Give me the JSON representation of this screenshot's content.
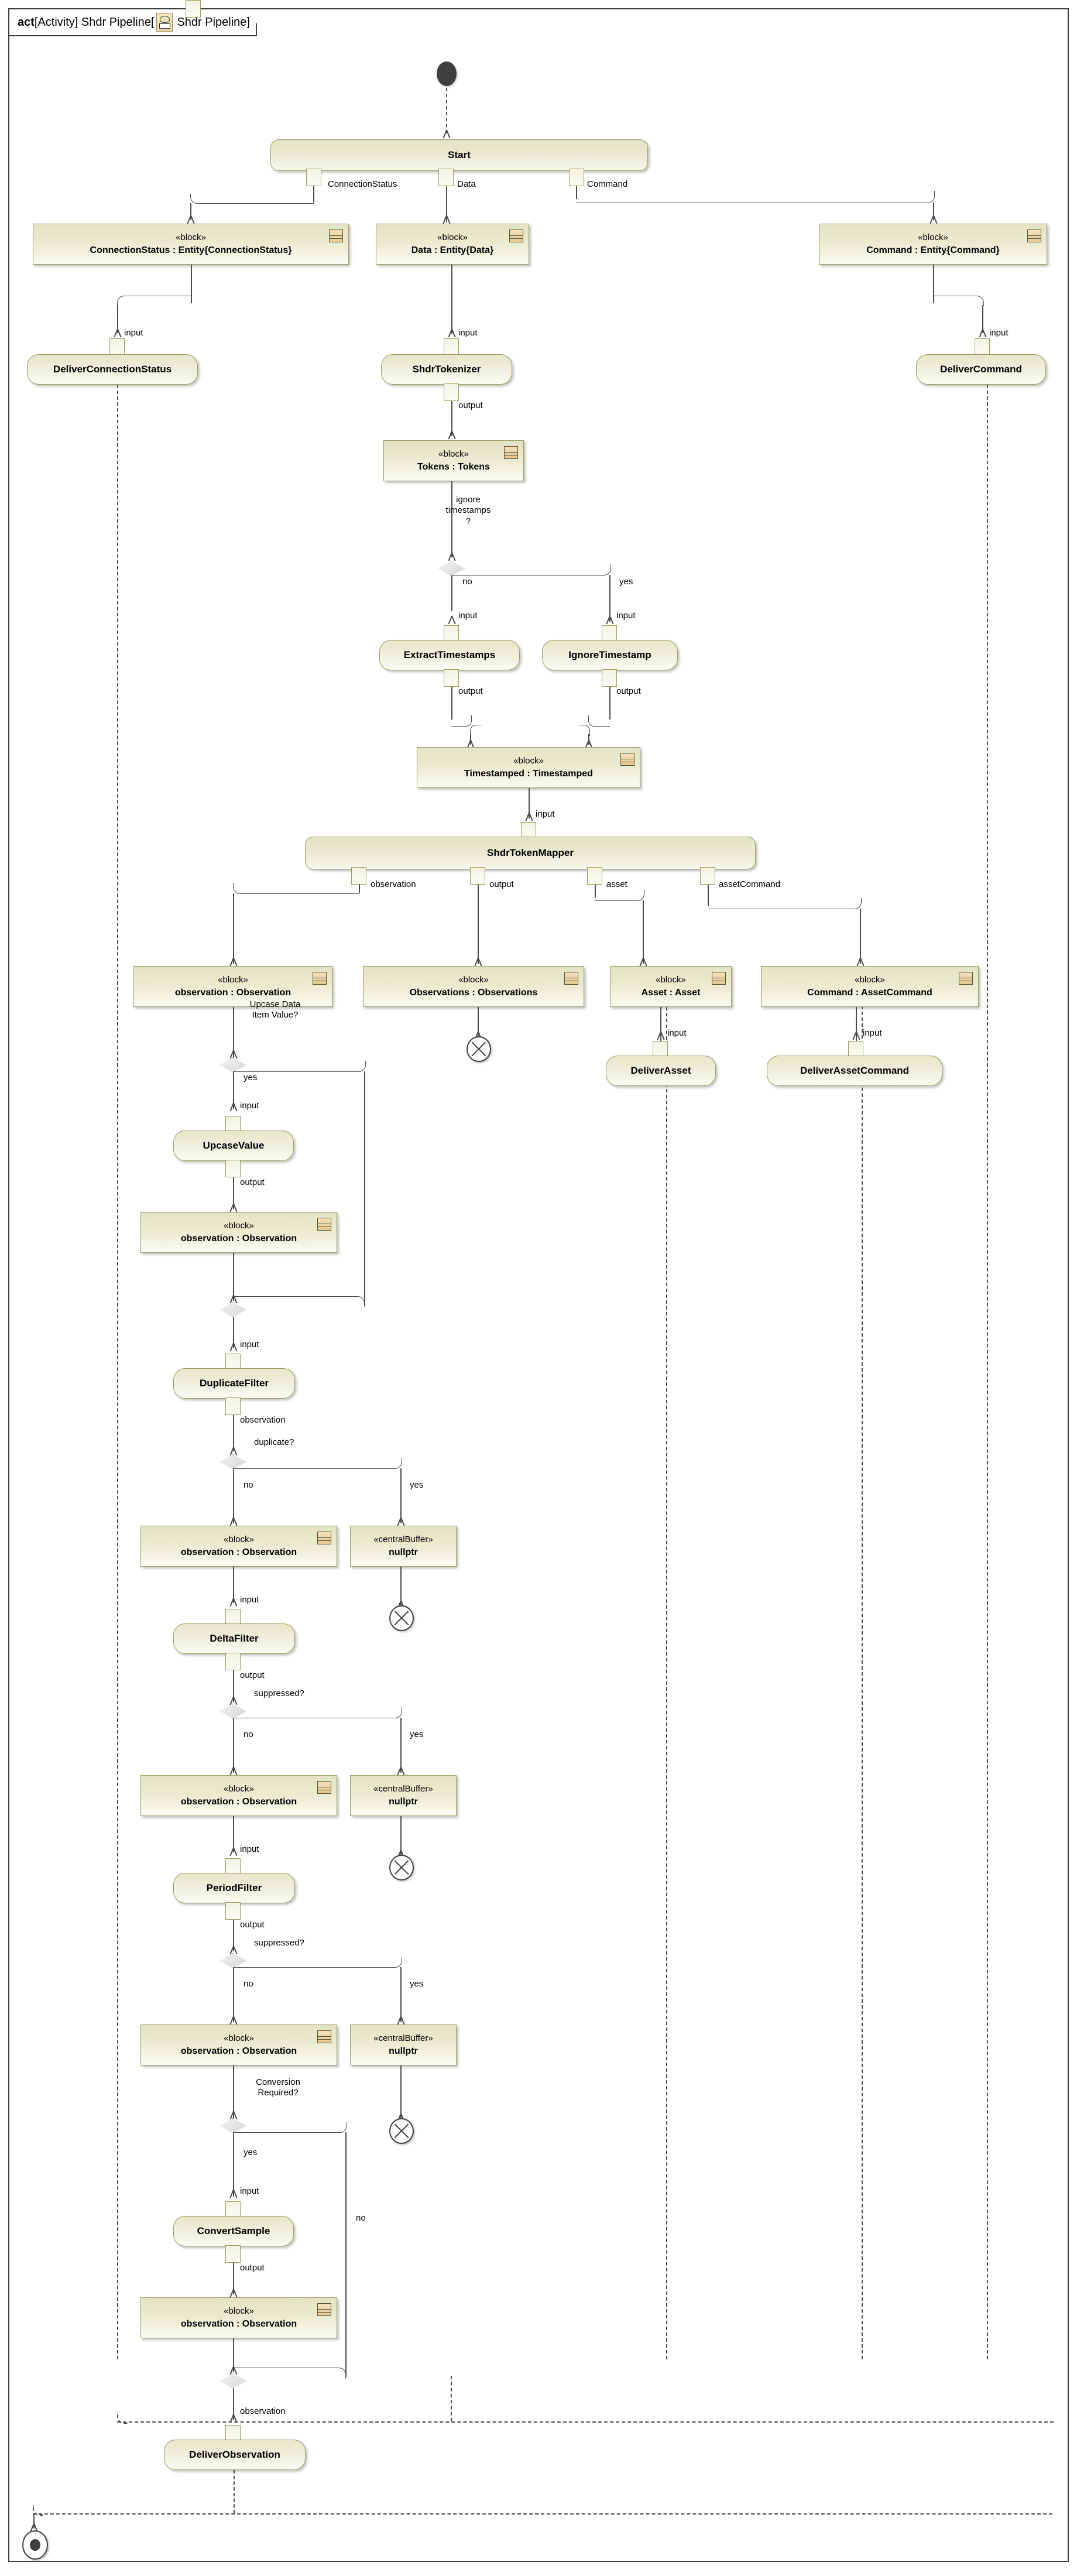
{
  "frame": {
    "keyword": "act",
    "title": " [Activity] Shdr Pipeline[ ",
    "title_tail": " Shdr Pipeline]",
    "icon": "activity-diagram-icon"
  },
  "nodes": {
    "initial": {
      "name": "initial-node"
    },
    "start": {
      "label": "Start"
    },
    "connection_status_block": {
      "stereotype": "«block»",
      "name": "ConnectionStatus : Entity{ConnectionStatus}"
    },
    "data_block": {
      "stereotype": "«block»",
      "name": "Data : Entity{Data}"
    },
    "command_block": {
      "stereotype": "«block»",
      "name": "Command : Entity{Command}"
    },
    "deliver_connection_status": {
      "label": "DeliverConnectionStatus"
    },
    "shdr_tokenizer": {
      "label": "ShdrTokenizer"
    },
    "deliver_command": {
      "label": "DeliverCommand"
    },
    "tokens_block": {
      "stereotype": "«block»",
      "name": "Tokens : Tokens"
    },
    "extract_timestamps": {
      "label": "ExtractTimestamps"
    },
    "ignore_timestamp": {
      "label": "IgnoreTimestamp"
    },
    "timestamped_block": {
      "stereotype": "«block»",
      "name": "Timestamped : Timestamped"
    },
    "shdr_token_mapper": {
      "label": "ShdrTokenMapper"
    },
    "observation_block_1": {
      "stereotype": "«block»",
      "name": "observation : Observation"
    },
    "observations_block": {
      "stereotype": "«block»",
      "name": "Observations : Observations"
    },
    "asset_block": {
      "stereotype": "«block»",
      "name": "Asset : Asset"
    },
    "asset_command_block": {
      "stereotype": "«block»",
      "name": "Command : AssetCommand"
    },
    "deliver_asset": {
      "label": "DeliverAsset"
    },
    "deliver_asset_command": {
      "label": "DeliverAssetCommand"
    },
    "upcase_value": {
      "label": "UpcaseValue"
    },
    "observation_block_2": {
      "stereotype": "«block»",
      "name": "observation : Observation"
    },
    "duplicate_filter": {
      "label": "DuplicateFilter"
    },
    "observation_block_3": {
      "stereotype": "«block»",
      "name": "observation : Observation"
    },
    "nullptr_1": {
      "stereotype": "«centralBuffer»",
      "name": "nullptr"
    },
    "delta_filter": {
      "label": "DeltaFilter"
    },
    "observation_block_4": {
      "stereotype": "«block»",
      "name": "observation : Observation"
    },
    "nullptr_2": {
      "stereotype": "«centralBuffer»",
      "name": "nullptr"
    },
    "period_filter": {
      "label": "PeriodFilter"
    },
    "observation_block_5": {
      "stereotype": "«block»",
      "name": "observation : Observation"
    },
    "nullptr_3": {
      "stereotype": "«centralBuffer»",
      "name": "nullptr"
    },
    "convert_sample": {
      "label": "ConvertSample"
    },
    "observation_block_6": {
      "stereotype": "«block»",
      "name": "observation : Observation"
    },
    "deliver_observation": {
      "label": "DeliverObservation"
    },
    "final": {
      "name": "activity-final-node"
    }
  },
  "edge_labels": {
    "connection_status": "ConnectionStatus",
    "data": "Data",
    "command": "Command",
    "input": "input",
    "output": "output",
    "observation": "observation",
    "asset": "asset",
    "asset_command": "assetCommand",
    "yes": "yes",
    "no": "no"
  },
  "decisions": {
    "ignore_timestamps": "ignore\ntimestamps\n?",
    "ignore_timestamps_l1": "ignore",
    "ignore_timestamps_l2": "timestamps",
    "ignore_timestamps_l3": "?",
    "upcase_l1": "Upcase Data",
    "upcase_l2": "Item Value?",
    "duplicate": "duplicate?",
    "suppressed_delta": "suppressed?",
    "suppressed_period": "suppressed?",
    "conversion_l1": "Conversion",
    "conversion_l2": "Required?"
  },
  "colors": {
    "node_fill_top": "#e3e3c4",
    "node_fill_bottom": "#fbfbf3",
    "node_border": "#9c9c63",
    "edge": "#4a4a4a",
    "frame_border": "#3f3f3f",
    "diamond_fill": "#e8e8e8"
  }
}
